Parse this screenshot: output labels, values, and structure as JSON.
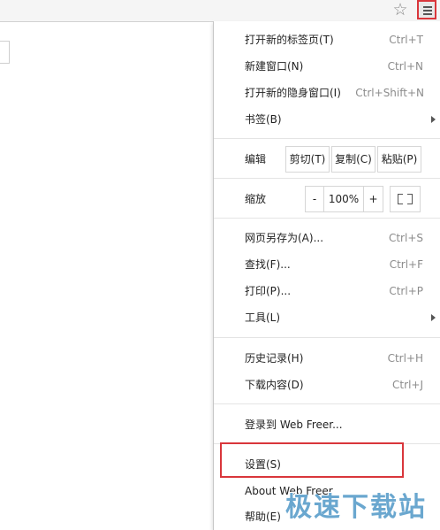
{
  "toolbar": {
    "star_icon": "☆",
    "menu_icon": "hamburger-menu-icon"
  },
  "menu": {
    "new_tab": {
      "label": "打开新的标签页(T)",
      "shortcut": "Ctrl+T"
    },
    "new_window": {
      "label": "新建窗口(N)",
      "shortcut": "Ctrl+N"
    },
    "new_incognito": {
      "label": "打开新的隐身窗口(I)",
      "shortcut": "Ctrl+Shift+N"
    },
    "bookmarks": {
      "label": "书签(B)"
    },
    "edit": {
      "label": "编辑",
      "cut": "剪切(T)",
      "copy": "复制(C)",
      "paste": "粘贴(P)"
    },
    "zoom": {
      "label": "缩放",
      "minus": "-",
      "value": "100%",
      "plus": "+"
    },
    "save_page": {
      "label": "网页另存为(A)...",
      "shortcut": "Ctrl+S"
    },
    "find": {
      "label": "查找(F)...",
      "shortcut": "Ctrl+F"
    },
    "print": {
      "label": "打印(P)...",
      "shortcut": "Ctrl+P"
    },
    "tools": {
      "label": "工具(L)"
    },
    "history": {
      "label": "历史记录(H)",
      "shortcut": "Ctrl+H"
    },
    "downloads": {
      "label": "下载内容(D)",
      "shortcut": "Ctrl+J"
    },
    "sign_in": {
      "label": "登录到 Web Freer..."
    },
    "settings": {
      "label": "设置(S)"
    },
    "about": {
      "label": "About Web Freer"
    },
    "help": {
      "label": "帮助(E)"
    }
  },
  "watermark": {
    "text": "极速下载站"
  },
  "colors": {
    "highlight": "#d9363b",
    "watermark": "#6aa7cf"
  }
}
